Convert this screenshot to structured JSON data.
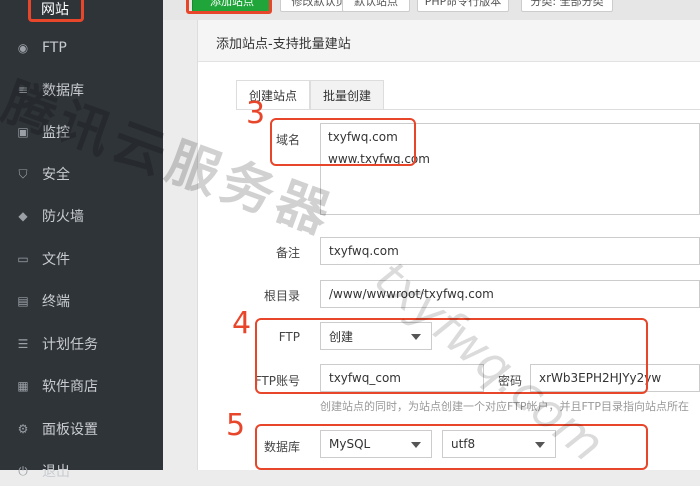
{
  "sidebar": {
    "active": "网站",
    "items": [
      {
        "label": "FTP",
        "icon": "ftp-icon"
      },
      {
        "label": "数据库",
        "icon": "database-icon"
      },
      {
        "label": "监控",
        "icon": "monitor-icon"
      },
      {
        "label": "安全",
        "icon": "shield-icon"
      },
      {
        "label": "防火墙",
        "icon": "firewall-icon"
      },
      {
        "label": "文件",
        "icon": "folder-icon"
      },
      {
        "label": "终端",
        "icon": "terminal-icon"
      },
      {
        "label": "计划任务",
        "icon": "task-icon"
      },
      {
        "label": "软件商店",
        "icon": "store-icon"
      },
      {
        "label": "面板设置",
        "icon": "settings-icon"
      },
      {
        "label": "退出",
        "icon": "logout-icon"
      }
    ]
  },
  "toolbar": {
    "buttons": [
      "添加站点",
      "修改默认页",
      "默认站点",
      "PHP命令行版本",
      "分类: 全部分类"
    ]
  },
  "dialog": {
    "title": "添加站点-支持批量建站",
    "tabs": [
      "创建站点",
      "批量创建"
    ],
    "domain_label": "域名",
    "domains": [
      "txyfwq.com",
      "www.txyfwq.com"
    ],
    "remark_label": "备注",
    "remark_value": "txyfwq.com",
    "root_label": "根目录",
    "root_value": "/www/wwwroot/txyfwq.com",
    "ftp_label": "FTP",
    "ftp_value": "创建",
    "ftp_account_label": "FTP账号",
    "ftp_account_value": "txyfwq_com",
    "password_label": "密码",
    "password_value": "xrWb3EPH2HJYy2yw",
    "hint": "创建站点的同时，为站点创建一个对应FTP帐户，并且FTP目录指向站点所在",
    "db_label": "数据库",
    "db_value": "MySQL",
    "charset_value": "utf8"
  },
  "annotations": {
    "step3": "3",
    "step4": "4",
    "step5": "5"
  },
  "watermark": {
    "text": "腾讯云服务器",
    "url": "txyfwq.com"
  },
  "colors": {
    "sidebar_bg": "#2f3439",
    "accent": "#20a53a",
    "annotation_red": "#e8462b"
  }
}
